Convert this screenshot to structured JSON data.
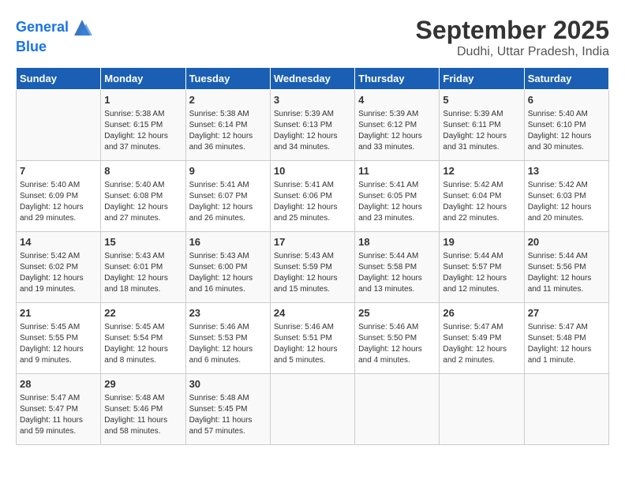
{
  "header": {
    "logo_line1": "General",
    "logo_line2": "Blue",
    "month": "September 2025",
    "location": "Dudhi, Uttar Pradesh, India"
  },
  "days_of_week": [
    "Sunday",
    "Monday",
    "Tuesday",
    "Wednesday",
    "Thursday",
    "Friday",
    "Saturday"
  ],
  "weeks": [
    [
      {
        "day": "",
        "info": ""
      },
      {
        "day": "1",
        "info": "Sunrise: 5:38 AM\nSunset: 6:15 PM\nDaylight: 12 hours\nand 37 minutes."
      },
      {
        "day": "2",
        "info": "Sunrise: 5:38 AM\nSunset: 6:14 PM\nDaylight: 12 hours\nand 36 minutes."
      },
      {
        "day": "3",
        "info": "Sunrise: 5:39 AM\nSunset: 6:13 PM\nDaylight: 12 hours\nand 34 minutes."
      },
      {
        "day": "4",
        "info": "Sunrise: 5:39 AM\nSunset: 6:12 PM\nDaylight: 12 hours\nand 33 minutes."
      },
      {
        "day": "5",
        "info": "Sunrise: 5:39 AM\nSunset: 6:11 PM\nDaylight: 12 hours\nand 31 minutes."
      },
      {
        "day": "6",
        "info": "Sunrise: 5:40 AM\nSunset: 6:10 PM\nDaylight: 12 hours\nand 30 minutes."
      }
    ],
    [
      {
        "day": "7",
        "info": "Sunrise: 5:40 AM\nSunset: 6:09 PM\nDaylight: 12 hours\nand 29 minutes."
      },
      {
        "day": "8",
        "info": "Sunrise: 5:40 AM\nSunset: 6:08 PM\nDaylight: 12 hours\nand 27 minutes."
      },
      {
        "day": "9",
        "info": "Sunrise: 5:41 AM\nSunset: 6:07 PM\nDaylight: 12 hours\nand 26 minutes."
      },
      {
        "day": "10",
        "info": "Sunrise: 5:41 AM\nSunset: 6:06 PM\nDaylight: 12 hours\nand 25 minutes."
      },
      {
        "day": "11",
        "info": "Sunrise: 5:41 AM\nSunset: 6:05 PM\nDaylight: 12 hours\nand 23 minutes."
      },
      {
        "day": "12",
        "info": "Sunrise: 5:42 AM\nSunset: 6:04 PM\nDaylight: 12 hours\nand 22 minutes."
      },
      {
        "day": "13",
        "info": "Sunrise: 5:42 AM\nSunset: 6:03 PM\nDaylight: 12 hours\nand 20 minutes."
      }
    ],
    [
      {
        "day": "14",
        "info": "Sunrise: 5:42 AM\nSunset: 6:02 PM\nDaylight: 12 hours\nand 19 minutes."
      },
      {
        "day": "15",
        "info": "Sunrise: 5:43 AM\nSunset: 6:01 PM\nDaylight: 12 hours\nand 18 minutes."
      },
      {
        "day": "16",
        "info": "Sunrise: 5:43 AM\nSunset: 6:00 PM\nDaylight: 12 hours\nand 16 minutes."
      },
      {
        "day": "17",
        "info": "Sunrise: 5:43 AM\nSunset: 5:59 PM\nDaylight: 12 hours\nand 15 minutes."
      },
      {
        "day": "18",
        "info": "Sunrise: 5:44 AM\nSunset: 5:58 PM\nDaylight: 12 hours\nand 13 minutes."
      },
      {
        "day": "19",
        "info": "Sunrise: 5:44 AM\nSunset: 5:57 PM\nDaylight: 12 hours\nand 12 minutes."
      },
      {
        "day": "20",
        "info": "Sunrise: 5:44 AM\nSunset: 5:56 PM\nDaylight: 12 hours\nand 11 minutes."
      }
    ],
    [
      {
        "day": "21",
        "info": "Sunrise: 5:45 AM\nSunset: 5:55 PM\nDaylight: 12 hours\nand 9 minutes."
      },
      {
        "day": "22",
        "info": "Sunrise: 5:45 AM\nSunset: 5:54 PM\nDaylight: 12 hours\nand 8 minutes."
      },
      {
        "day": "23",
        "info": "Sunrise: 5:46 AM\nSunset: 5:53 PM\nDaylight: 12 hours\nand 6 minutes."
      },
      {
        "day": "24",
        "info": "Sunrise: 5:46 AM\nSunset: 5:51 PM\nDaylight: 12 hours\nand 5 minutes."
      },
      {
        "day": "25",
        "info": "Sunrise: 5:46 AM\nSunset: 5:50 PM\nDaylight: 12 hours\nand 4 minutes."
      },
      {
        "day": "26",
        "info": "Sunrise: 5:47 AM\nSunset: 5:49 PM\nDaylight: 12 hours\nand 2 minutes."
      },
      {
        "day": "27",
        "info": "Sunrise: 5:47 AM\nSunset: 5:48 PM\nDaylight: 12 hours\nand 1 minute."
      }
    ],
    [
      {
        "day": "28",
        "info": "Sunrise: 5:47 AM\nSunset: 5:47 PM\nDaylight: 11 hours\nand 59 minutes."
      },
      {
        "day": "29",
        "info": "Sunrise: 5:48 AM\nSunset: 5:46 PM\nDaylight: 11 hours\nand 58 minutes."
      },
      {
        "day": "30",
        "info": "Sunrise: 5:48 AM\nSunset: 5:45 PM\nDaylight: 11 hours\nand 57 minutes."
      },
      {
        "day": "",
        "info": ""
      },
      {
        "day": "",
        "info": ""
      },
      {
        "day": "",
        "info": ""
      },
      {
        "day": "",
        "info": ""
      }
    ]
  ]
}
